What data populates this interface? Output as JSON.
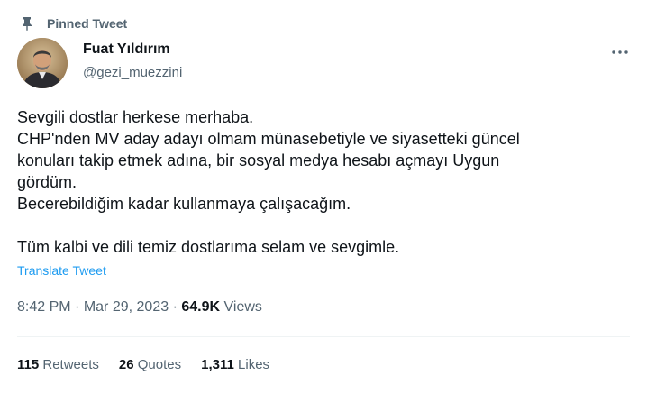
{
  "pinned": {
    "label": "Pinned Tweet",
    "icon": "pin-icon"
  },
  "author": {
    "name": "Fuat Yıldırım",
    "handle": "@gezi_muezzini"
  },
  "more_icon": "more-dots-icon",
  "tweet": {
    "lines": [
      "Sevgili dostlar herkese merhaba.",
      "CHP'nden MV aday adayı olmam münasebetiyle ve siyasetteki güncel",
      "konuları takip etmek adına, bir sosyal medya hesabı açmayı Uygun",
      "gördüm.",
      "Becerebildiğim kadar kullanmaya çalışacağım.",
      "",
      "Tüm kalbi ve dili temiz dostlarıma selam ve sevgimle."
    ],
    "translate_label": "Translate Tweet"
  },
  "meta": {
    "time": "8:42 PM",
    "separator": "·",
    "date": "Mar 29, 2023",
    "views_count": "64.9K",
    "views_label": "Views"
  },
  "stats": {
    "retweets_count": "115",
    "retweets_label": "Retweets",
    "quotes_count": "26",
    "quotes_label": "Quotes",
    "likes_count": "1,311",
    "likes_label": "Likes"
  },
  "colors": {
    "text": "#0f1419",
    "secondary": "#536471",
    "link": "#1d9bf0",
    "divider": "#eff3f4"
  }
}
